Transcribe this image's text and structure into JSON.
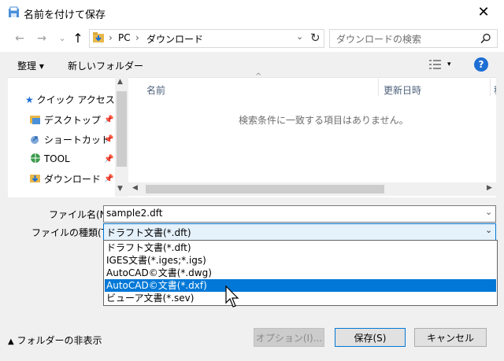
{
  "window": {
    "title": "名前を付けて保存"
  },
  "nav": {
    "back": "←",
    "forward": "→",
    "recent": "⌄",
    "up": "↑"
  },
  "address": {
    "root": "PC",
    "separator": "›",
    "folder": "ダウンロード",
    "refresh": "↻"
  },
  "search": {
    "placeholder": "ダウンロードの検索"
  },
  "toolbar": {
    "organize": "整理 ▾",
    "new_folder": "新しいフォルダー",
    "view": "▾",
    "help": "?"
  },
  "sidebar": {
    "items": [
      {
        "label": "クイック アクセス"
      },
      {
        "label": "デスクトップ"
      },
      {
        "label": "ショートカット"
      },
      {
        "label": "TOOL"
      },
      {
        "label": "ダウンロード"
      }
    ]
  },
  "filelist": {
    "col_name": "名前",
    "col_date": "更新日時",
    "col_type": "種",
    "empty_message": "検索条件に一致する項目はありません。"
  },
  "form": {
    "filename_label": "ファイル名(N):",
    "filename_value": "sample2.dft",
    "filetype_label": "ファイルの種類(T):",
    "filetype_value": "ドラフト文書(*.dft)",
    "filetype_options": [
      "ドラフト文書(*.dft)",
      "IGES文書(*.iges;*.igs)",
      "AutoCAD©文書(*.dwg)",
      "AutoCAD©文書(*.dxf)",
      "ビューア文書(*.sev)"
    ]
  },
  "footer": {
    "hide_folders": "フォルダーの非表示",
    "options_button": "オプション(I)...",
    "save_button": "保存(S)",
    "cancel_button": "キャンセル"
  },
  "colors": {
    "accent": "#0078d7",
    "selected_text": "#ffffff",
    "folder": "#e8b84a",
    "quick_star": "#1e6fd4"
  }
}
